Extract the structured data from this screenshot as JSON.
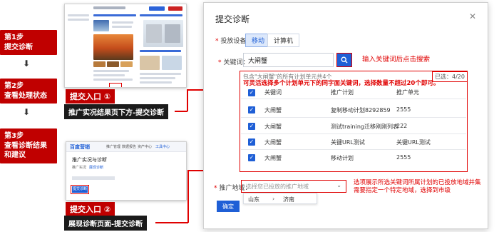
{
  "steps": [
    {
      "line1": "第1步",
      "line2": "提交诊断"
    },
    {
      "line1": "第2步",
      "line2": "查看处理状态"
    },
    {
      "line1": "第3步",
      "line2": "查看诊断结果",
      "line3": "和建议"
    }
  ],
  "arrow": "⬇",
  "entry1": {
    "title": "提交入口 ①",
    "desc": "推广实况结果页下方-提交诊断"
  },
  "entry2": {
    "title": "提交入口 ②",
    "desc": "展现诊断页面-提交诊断"
  },
  "thumb2": {
    "brand": "百度营销",
    "menu": [
      "推广管理",
      "数据报告",
      "资产中心",
      "工具中心"
    ],
    "heading": "推广实况与诊断",
    "tabs": [
      "推广实况",
      "展现诊断"
    ],
    "btn": "提交诊断"
  },
  "dialog": {
    "title": "提交诊断",
    "close": "✕",
    "device_label": "投放设备：",
    "device_tabs": [
      "移动",
      "计算机"
    ],
    "keyword_label": "关键词：",
    "keyword_value": "大闸蟹",
    "search_note": "输入关键词后点击搜索",
    "contains_text": "包含\"大闸蟹\"的所有计划单元共4个",
    "selected_text": "已选：4/20",
    "multi_note": "可灵活选择多个计划单元下的同字面关键词，选择数量不超过20个即可。",
    "columns": [
      "关键词",
      "推广计划",
      "推广单元"
    ],
    "rows": [
      {
        "kw": "大闸蟹",
        "plan": "复制移动计划8292859",
        "unit": "2555"
      },
      {
        "kw": "大闸蟹",
        "plan": "测试training迁移刚刚列表",
        "unit": "222"
      },
      {
        "kw": "大闸蟹",
        "plan": "关键URL测试",
        "unit": "关键URL测试"
      },
      {
        "kw": "大闸蟹",
        "plan": "移动计划",
        "unit": "2555"
      }
    ],
    "region_label": "推广地域：",
    "region_placeholder": "选择您已投放的推广地域",
    "region_note": "选项展示所选关键词所属计划的已投放地域并集\n需要指定一个特定地域，选择到市级",
    "region_options": [
      "山东",
      "济南"
    ],
    "confirm": "确定"
  },
  "colors": {
    "brand_red": "#c00000",
    "primary_blue": "#1f5fd6"
  }
}
